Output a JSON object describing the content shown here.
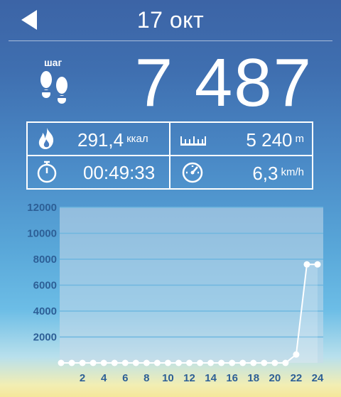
{
  "header": {
    "date": "17 окт",
    "back_icon": "back-arrow-icon"
  },
  "steps": {
    "label": "шаг",
    "value": "7 487",
    "icon": "footprints-icon"
  },
  "stats": {
    "calories": {
      "value": "291,4",
      "unit": "ккал",
      "icon": "flame-icon"
    },
    "distance": {
      "value": "5 240",
      "unit": "m",
      "icon": "ruler-icon"
    },
    "duration": {
      "value": "00:49:33",
      "icon": "stopwatch-icon"
    },
    "speed": {
      "value": "6,3",
      "unit": "km/h",
      "icon": "speedometer-icon"
    }
  },
  "colors": {
    "accent_axis_text": "#2d5f96",
    "grid": "#6fb7df",
    "plot_bg": "#c9dbe9"
  },
  "chart_data": {
    "type": "line",
    "title": "",
    "xlabel": "",
    "ylabel": "",
    "x_tick_labels": [
      "2",
      "4",
      "6",
      "8",
      "10",
      "12",
      "14",
      "16",
      "18",
      "20",
      "22",
      "24"
    ],
    "y_tick_labels": [
      "2000",
      "4000",
      "6000",
      "8000",
      "10000",
      "12000"
    ],
    "ylim": [
      0,
      12000
    ],
    "xlim": [
      0,
      24
    ],
    "grid": true,
    "series": [
      {
        "x": [
          0,
          1,
          2,
          3,
          4,
          5,
          6,
          7,
          8,
          9,
          10,
          11,
          12,
          13,
          14,
          15,
          16,
          17,
          18,
          19,
          20,
          21,
          22,
          23,
          24
        ],
        "values": [
          0,
          0,
          0,
          0,
          0,
          0,
          0,
          0,
          0,
          0,
          0,
          0,
          0,
          0,
          0,
          0,
          0,
          0,
          0,
          0,
          0,
          0,
          650,
          7600,
          7600
        ]
      }
    ]
  }
}
